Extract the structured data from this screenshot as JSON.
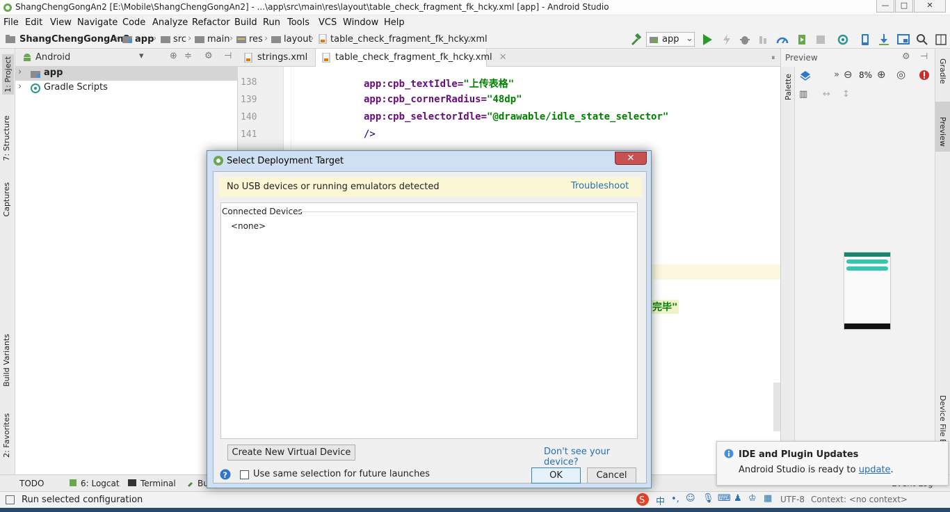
{
  "window": {
    "title": "ShangChengGongAn2 [E:\\Mobile\\ShangChengGongAn2] - ...\\app\\src\\main\\res\\layout\\table_check_fragment_fk_hcky.xml [app] - Android Studio",
    "minimize": "—",
    "maximize": "□",
    "close": "✕"
  },
  "menu": [
    "File",
    "Edit",
    "View",
    "Navigate",
    "Code",
    "Analyze",
    "Refactor",
    "Build",
    "Run",
    "Tools",
    "VCS",
    "Window",
    "Help"
  ],
  "breadcrumb": [
    "ShangChengGongAn2",
    "app",
    "src",
    "main",
    "res",
    "layout",
    "table_check_fragment_fk_hcky.xml"
  ],
  "toolbar": {
    "run_config": "app"
  },
  "left_tabs": [
    "1: Project",
    "7: Structure",
    "Captures",
    "Build Variants",
    "2: Favorites"
  ],
  "project": {
    "view_selector": "Android",
    "items": [
      {
        "label": "app",
        "selected": true
      },
      {
        "label": "Gradle Scripts",
        "selected": false
      }
    ]
  },
  "editor": {
    "tabs": [
      "strings.xml",
      "table_check_fragment_fk_hcky.xml"
    ],
    "active_tab": 1,
    "lines": [
      {
        "number": "138",
        "attr": "app:cpb_textIdle=",
        "value": "\"上传表格\""
      },
      {
        "number": "139",
        "attr": "app:cpb_cornerRadius=",
        "value": "\"48dp\""
      },
      {
        "number": "140",
        "attr": "app:cpb_selectorIdle=",
        "value": "\"@drawable/idle_state_selector\""
      },
      {
        "number": "141",
        "attr": "/>",
        "value": ""
      }
    ],
    "partial_text": "完毕\""
  },
  "preview": {
    "title": "Preview",
    "zoom": "8%",
    "palette_label": "Palette"
  },
  "right_tabs": [
    "Gradle",
    "Preview",
    "Device File E"
  ],
  "bottom_tools": [
    "TODO",
    "6: Logcat",
    "Terminal",
    "Bu"
  ],
  "status": {
    "message": "Run selected configuration",
    "encoding": "UTF-8",
    "context": "Context: <no context>",
    "event_log": "Event Log"
  },
  "dialog": {
    "title": "Select Deployment Target",
    "close": "✕",
    "warning": "No USB devices or running emulators detected",
    "troubleshoot": "Troubleshoot",
    "section": "Connected Devices",
    "devices": [
      "<none>"
    ],
    "create_button": "Create New Virtual Device",
    "dont_see": "Don't see your device?",
    "checkbox_label": "Use same selection for future launches",
    "checkbox_checked": false,
    "ok": "OK",
    "cancel": "Cancel"
  },
  "notification": {
    "title": "IDE and Plugin Updates",
    "message_prefix": "Android Studio is ready to ",
    "link": "update",
    "suffix": "."
  },
  "colors": {
    "accent_run": "#2a9a2a",
    "link": "#2470b3",
    "xml_attr": "#660e7a",
    "xml_value": "#008000"
  }
}
